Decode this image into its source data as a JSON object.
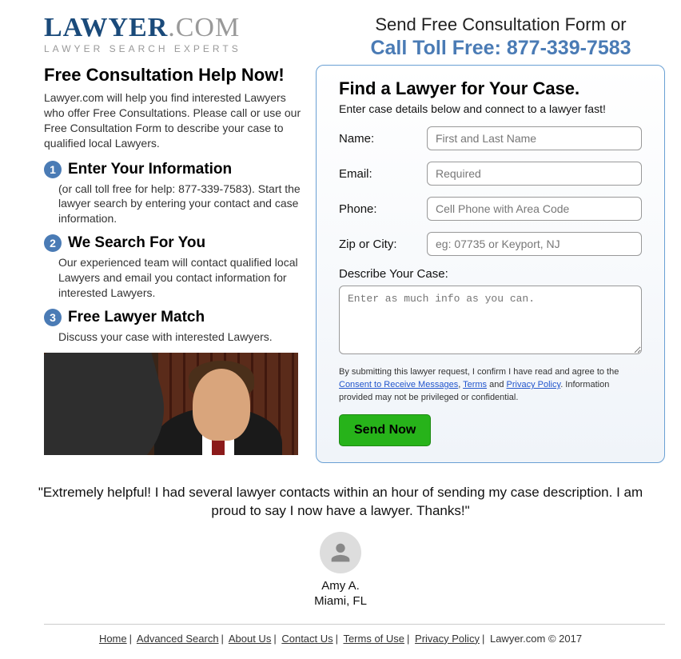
{
  "logo": {
    "navy": "LAWYER",
    "dot": ".",
    "com": "COM",
    "tagline": "LAWYER SEARCH EXPERTS"
  },
  "top": {
    "send_line": "Send Free Consultation Form or",
    "call_line": "Call Toll Free: 877-339-7583"
  },
  "headline": "Free Consultation Help Now!",
  "intro": "Lawyer.com will help you find interested Lawyers who offer Free Consultations. Please call or use our Free Consultation Form to describe your case to qualified local Lawyers.",
  "steps": [
    {
      "num": "1",
      "title": "Enter Your Information",
      "desc": "(or call toll free for help: 877-339-7583). Start the lawyer search by entering your contact and case information."
    },
    {
      "num": "2",
      "title": "We Search For You",
      "desc": "Our experienced team will contact qualified local Lawyers and email you contact information for interested Lawyers."
    },
    {
      "num": "3",
      "title": "Free Lawyer Match",
      "desc": "Discuss your case with interested Lawyers."
    }
  ],
  "form": {
    "title": "Find a Lawyer for Your Case.",
    "subtitle": "Enter case details below and connect to a lawyer fast!",
    "fields": {
      "name": {
        "label": "Name:",
        "placeholder": "First and Last Name"
      },
      "email": {
        "label": "Email:",
        "placeholder": "Required"
      },
      "phone": {
        "label": "Phone:",
        "placeholder": "Cell Phone with Area Code"
      },
      "zip": {
        "label": "Zip or City:",
        "placeholder": "eg: 07735 or Keyport, NJ"
      },
      "describe": {
        "label": "Describe Your Case:",
        "placeholder": "Enter as much info as you can."
      }
    },
    "disclaimer": {
      "pre": "By submitting this lawyer request, I confirm I have read and agree to the ",
      "consent": "Consent to Receive Messages",
      "comma": ", ",
      "terms": "Terms",
      "and": " and ",
      "privacy": "Privacy Policy",
      "post": ". Information provided may not be privileged or confidential."
    },
    "send_btn": "Send Now"
  },
  "testimonial": {
    "quote": "\"Extremely helpful! I had several lawyer contacts within an hour of sending my case description. I am proud to say I now have a lawyer. Thanks!\"",
    "name": "Amy A.",
    "loc": "Miami, FL"
  },
  "footer": {
    "links": [
      "Home",
      "Advanced Search",
      "About Us",
      "Contact Us",
      "Terms of Use",
      "Privacy Policy"
    ],
    "copyright": "Lawyer.com © 2017"
  }
}
